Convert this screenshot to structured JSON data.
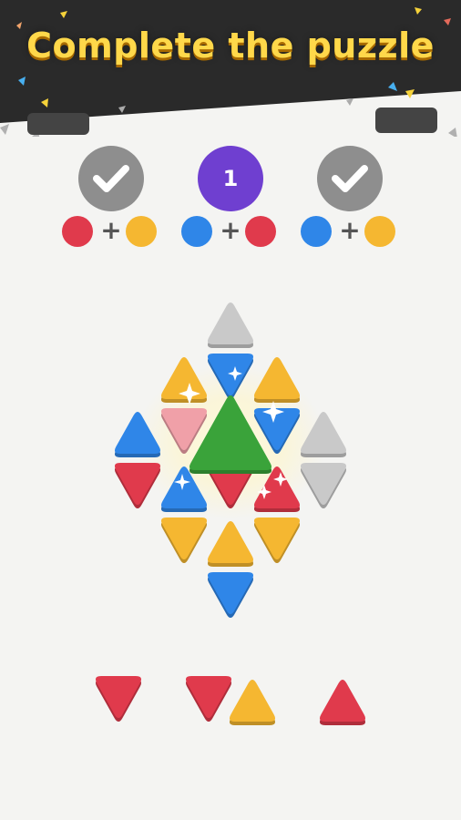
{
  "title": "Complete the puzzle",
  "colors": {
    "red": "#e03a4c",
    "yellow": "#f5b731",
    "blue": "#2f86e8",
    "gray": "#c9c9c9",
    "green": "#3aa33a",
    "pink": "#f0a0a8",
    "banner": "#2a2a2a",
    "goal_done": "#8e8e8e",
    "goal_active": "#6f3fd0"
  },
  "goals": [
    {
      "status": "done",
      "icon": "check-icon",
      "recipe": [
        "red",
        "yellow"
      ]
    },
    {
      "status": "active",
      "count": "1",
      "recipe": [
        "blue",
        "red"
      ]
    },
    {
      "status": "done",
      "icon": "check-icon",
      "recipe": [
        "blue",
        "yellow"
      ]
    }
  ],
  "board": [
    {
      "row": 0,
      "col": 0,
      "color": "gray"
    },
    {
      "row": 1,
      "col": -1,
      "color": "yellow"
    },
    {
      "row": 1,
      "col": 0,
      "color": "blue"
    },
    {
      "row": 1,
      "col": 1,
      "color": "yellow"
    },
    {
      "row": 2,
      "col": -2,
      "color": "blue"
    },
    {
      "row": 2,
      "col": -1,
      "color": "pink"
    },
    {
      "row": 2,
      "col": 0,
      "color": "green"
    },
    {
      "row": 2,
      "col": 1,
      "color": "blue"
    },
    {
      "row": 2,
      "col": 2,
      "color": "gray"
    },
    {
      "row": 3,
      "col": -2,
      "color": "red"
    },
    {
      "row": 3,
      "col": -1,
      "color": "blue"
    },
    {
      "row": 3,
      "col": 0,
      "color": "red"
    },
    {
      "row": 3,
      "col": 1,
      "color": "red"
    },
    {
      "row": 3,
      "col": 2,
      "color": "gray"
    },
    {
      "row": 4,
      "col": -1,
      "color": "yellow"
    },
    {
      "row": 4,
      "col": 0,
      "color": "yellow"
    },
    {
      "row": 4,
      "col": 1,
      "color": "yellow"
    },
    {
      "row": 5,
      "col": 0,
      "color": "blue"
    }
  ],
  "tray": [
    {
      "pieces": [
        {
          "color": "red",
          "dir": "down"
        }
      ]
    },
    {
      "pieces": [
        {
          "color": "red",
          "dir": "down"
        },
        {
          "color": "yellow",
          "dir": "up"
        }
      ]
    },
    {
      "pieces": [
        {
          "color": "red",
          "dir": "up"
        }
      ]
    }
  ]
}
